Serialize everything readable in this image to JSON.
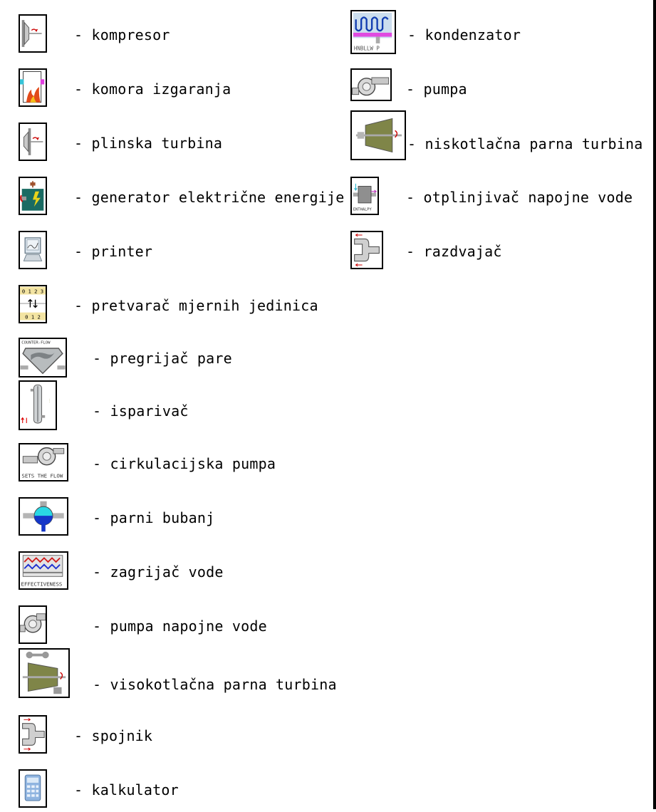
{
  "legend": {
    "left": [
      {
        "label": "- kompresor",
        "icon": "compressor-icon"
      },
      {
        "label": "- komora izgaranja",
        "icon": "combustion-chamber-icon"
      },
      {
        "label": "- plinska turbina",
        "icon": "gas-turbine-icon"
      },
      {
        "label": "- generator električne energije",
        "icon": "generator-icon"
      },
      {
        "label": "- printer",
        "icon": "printer-icon"
      },
      {
        "label": "- pretvarač mjernih jedinica",
        "icon": "unit-converter-icon"
      },
      {
        "label": "- pregrijač pare",
        "icon": "superheater-icon"
      },
      {
        "label": "- isparivač",
        "icon": "evaporator-icon"
      },
      {
        "label": "- cirkulacijska pumpa",
        "icon": "circulation-pump-icon"
      },
      {
        "label": "- parni bubanj",
        "icon": "steam-drum-icon"
      },
      {
        "label": "- zagrijač vode",
        "icon": "water-heater-icon"
      },
      {
        "label": "- pumpa napojne vode",
        "icon": "feedwater-pump-icon"
      },
      {
        "label": "- visokotlačna parna turbina",
        "icon": "hp-steam-turbine-icon"
      },
      {
        "label": "- spojnik",
        "icon": "mixer-icon"
      },
      {
        "label": "- kalkulator",
        "icon": "calculator-icon"
      }
    ],
    "right": [
      {
        "label": "- kondenzator",
        "icon": "condenser-icon"
      },
      {
        "label": "- pumpa",
        "icon": "pump-icon"
      },
      {
        "label": "- niskotlačna parna turbina",
        "icon": "lp-steam-turbine-icon"
      },
      {
        "label": "- otplinjivač napojne vode",
        "icon": "deaerator-icon"
      },
      {
        "label": "- razdvajač",
        "icon": "splitter-icon"
      }
    ],
    "icon_captions": {
      "condenser": "HNBLLW P",
      "circulation_pump": "SETS THE FLOW",
      "superheater": "COUNTER-FLOW",
      "water_heater": "EFFECTIVENESS",
      "deaerator": "ENTHALPY",
      "converter_top": "0 1 2 3",
      "converter_bottom": "0 1 2"
    }
  }
}
